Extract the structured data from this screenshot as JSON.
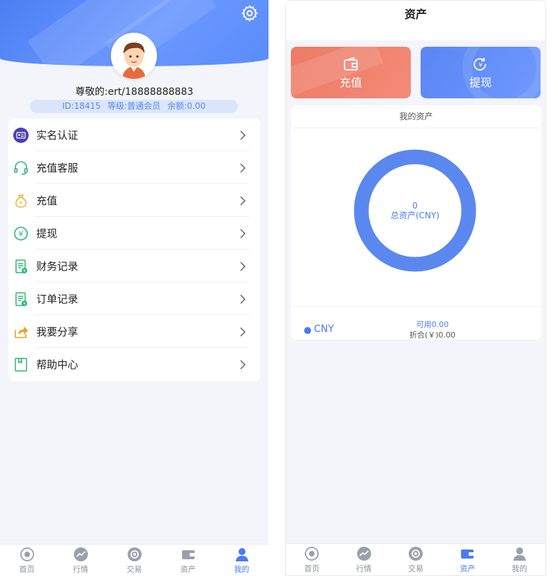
{
  "profile": {
    "greeting": "尊敬的:ert/18888888883",
    "id_text": "ID:18415",
    "level_text": "等级:普通会员",
    "balance_text": "余额:0.00"
  },
  "menu": {
    "items": [
      {
        "label": "实名认证",
        "icon": "id-card-icon"
      },
      {
        "label": "充值客服",
        "icon": "headset-icon"
      },
      {
        "label": "充值",
        "icon": "money-bag-icon"
      },
      {
        "label": "提现",
        "icon": "yuan-coin-icon"
      },
      {
        "label": "财务记录",
        "icon": "document-yuan-icon"
      },
      {
        "label": "订单记录",
        "icon": "document-yuan-icon"
      },
      {
        "label": "我要分享",
        "icon": "share-icon"
      },
      {
        "label": "帮助中心",
        "icon": "help-book-icon"
      }
    ]
  },
  "tabbar": {
    "items": [
      {
        "label": "首页",
        "icon": "home-icon"
      },
      {
        "label": "行情",
        "icon": "trend-icon"
      },
      {
        "label": "交易",
        "icon": "trade-icon"
      },
      {
        "label": "资产",
        "icon": "wallet-icon"
      },
      {
        "label": "我的",
        "icon": "user-icon"
      }
    ]
  },
  "assets": {
    "page_title": "资产",
    "recharge_label": "充值",
    "withdraw_label": "提现",
    "section_title": "我的资产",
    "total_value": "0",
    "total_label": "总资产(CNY)",
    "currency": "CNY",
    "available": "可用0.00",
    "converted": "折合(￥)0.00"
  },
  "colors": {
    "primary": "#4a7bf0",
    "recharge": "#ee7b66",
    "withdraw": "#5a86f4"
  }
}
